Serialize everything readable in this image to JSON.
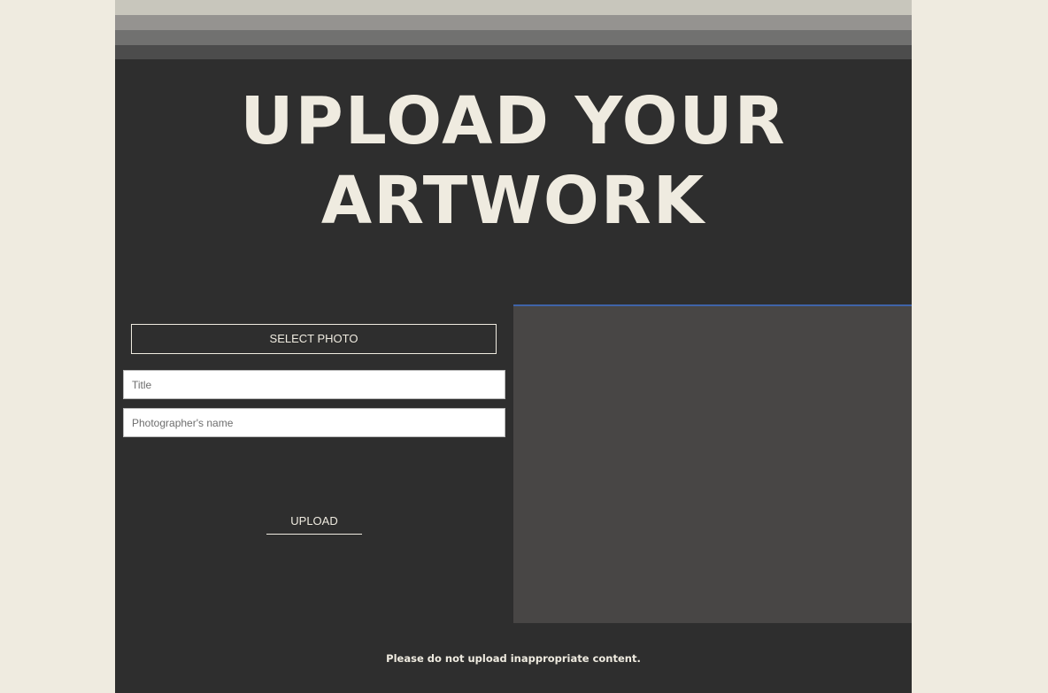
{
  "header": {
    "title_line1": "UPLOAD YOUR",
    "title_line2": "ARTWORK"
  },
  "form": {
    "select_photo_label": "SELECT PHOTO",
    "title_placeholder": "Title",
    "title_value": "",
    "photographer_placeholder": "Photographer's name",
    "photographer_value": "",
    "upload_label": "UPLOAD"
  },
  "footer": {
    "notice": "Please do not upload inappropriate content."
  },
  "colors": {
    "background": "#efebe0",
    "panel": "#2e2e2e",
    "preview": "#484645",
    "preview_accent": "#3f63a8",
    "text": "#efebe0"
  }
}
